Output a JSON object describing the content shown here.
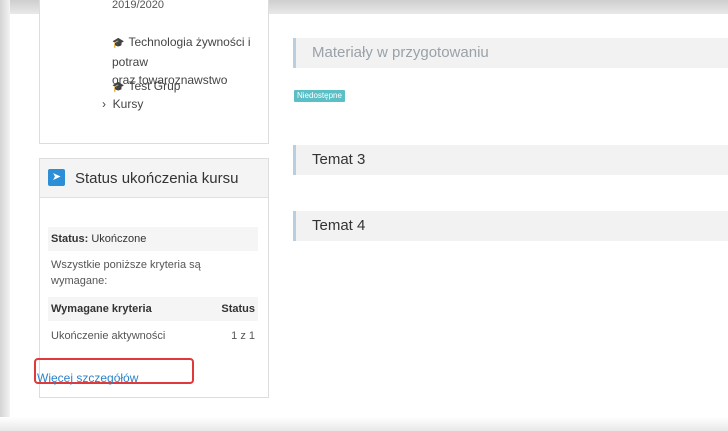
{
  "nav": {
    "cut_text": "2019/2020",
    "items": [
      {
        "icon": "graduation-cap-icon",
        "label": "Technologia żywności i potraw",
        "label2": "oraz towaroznawstwo"
      },
      {
        "icon": "graduation-cap-icon",
        "label": "Test Grup"
      }
    ],
    "kursy": {
      "chevron": "›",
      "label": "Kursy"
    }
  },
  "status_block": {
    "icon": "pin-icon",
    "title": "Status ukończenia kursu",
    "status_label": "Status:",
    "status_value": "Ukończone",
    "criteria_note": "Wszystkie poniższe kryteria są wymagane:",
    "table": {
      "headers": [
        "Wymagane kryteria",
        "Status"
      ],
      "rows": [
        [
          "Ukończenie aktywności",
          "1 z 1"
        ]
      ]
    },
    "details_link": "Więcej szczegółów",
    "highlight_color": "#e0393b"
  },
  "sections": [
    {
      "title": "Materiały w przygotowaniu",
      "badge": "Niedostępne"
    },
    {
      "title": "Temat 3"
    },
    {
      "title": "Temat 4"
    }
  ],
  "colors": {
    "accent": "#2c8ed6",
    "badge": "#5bc0c6",
    "link": "#2a83c8"
  }
}
